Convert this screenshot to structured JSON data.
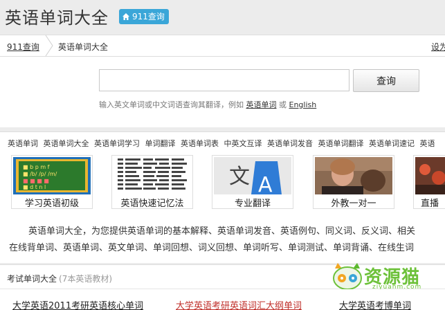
{
  "header": {
    "site_title": "英语单词大全",
    "badge_label": "911查询",
    "badge_icon": "home-icon"
  },
  "breadcrumb": {
    "home": "911查询",
    "current": "英语单词大全",
    "right_link": "设为"
  },
  "search": {
    "placeholder": "",
    "button_label": "查询",
    "hint_prefix": "输入英文单词或中文词语查询其翻译，例如",
    "example_1": "英语单词",
    "hint_or": "或",
    "example_2": "English"
  },
  "tags": [
    "英语单词",
    "英语单词大全",
    "英语单词学习",
    "单词翻译",
    "英语单词表",
    "中英文互译",
    "英语单词发音",
    "英语单词翻译",
    "英语单词速记",
    "英语"
  ],
  "thumbs": [
    {
      "label": "学习英语初级",
      "icon": "phonics-chart-image"
    },
    {
      "label": "英语快速记忆法",
      "icon": "word-list-image"
    },
    {
      "label": "专业翻译",
      "icon": "translate-icon"
    },
    {
      "label": "外教一对一",
      "icon": "tutor-photo"
    },
    {
      "label": "直播",
      "icon": "live-photo"
    }
  ],
  "description": {
    "line1": "英语单词大全，为您提供英语单词的基本解释、英语单词发音、英语例句、同义词、反义词、相关",
    "line2": "在线背单词、英语单词、英文单词、单词回想、词义回想、单词听写、单词测试、单词背诵、在线生词"
  },
  "exam_section": {
    "title": "考试单词大全",
    "subtitle": "(7本英语教材)"
  },
  "watermark": {
    "text": "资源猫",
    "sub": "ziyuanm.com"
  },
  "books": [
    {
      "label": "大学英语2011考研英语核心单词",
      "color": "#222222"
    },
    {
      "label": "大学英语考研英语词汇大纲单词",
      "color": "#c0302b"
    },
    {
      "label": "大学英语考博单词",
      "color": "#222222"
    }
  ],
  "colors": {
    "badge_bg": "#3aa6d8",
    "page_bg": "#ececec",
    "link_red": "#c0302b",
    "watermark_green": "#6dc13a"
  }
}
